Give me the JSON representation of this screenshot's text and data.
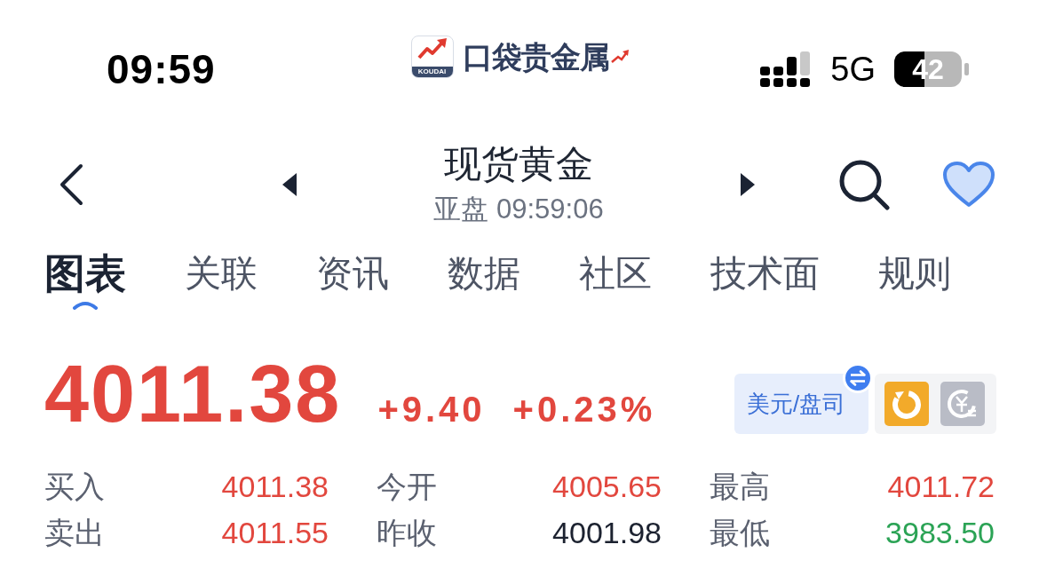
{
  "status_bar": {
    "time": "09:59",
    "network": "5G",
    "battery": "42"
  },
  "logo": {
    "caption": "KOUDAI",
    "name": "口袋贵金属"
  },
  "header": {
    "title": "现货黄金",
    "subtitle": "亚盘 09:59:06",
    "favorite": true
  },
  "tabs": [
    {
      "label": "图表",
      "selected": true
    },
    {
      "label": "关联",
      "selected": false
    },
    {
      "label": "资讯",
      "selected": false
    },
    {
      "label": "数据",
      "selected": false
    },
    {
      "label": "社区",
      "selected": false
    },
    {
      "label": "技术面",
      "selected": false
    },
    {
      "label": "规则",
      "selected": false
    }
  ],
  "quote": {
    "price": "4011.38",
    "change": "+9.40",
    "change_percent": "+0.23%",
    "unit": "美元/盘司"
  },
  "stats": [
    {
      "label": "买入",
      "value": "4011.38",
      "color": "#e2473e"
    },
    {
      "label": "今开",
      "value": "4005.65",
      "color": "#e2473e"
    },
    {
      "label": "最高",
      "value": "4011.72",
      "color": "#e2473e"
    },
    {
      "label": "卖出",
      "value": "4011.55",
      "color": "#e2473e"
    },
    {
      "label": "昨收",
      "value": "4001.98",
      "color": "#1c2230"
    },
    {
      "label": "最低",
      "value": "3983.50",
      "color": "#2ba355"
    }
  ]
}
